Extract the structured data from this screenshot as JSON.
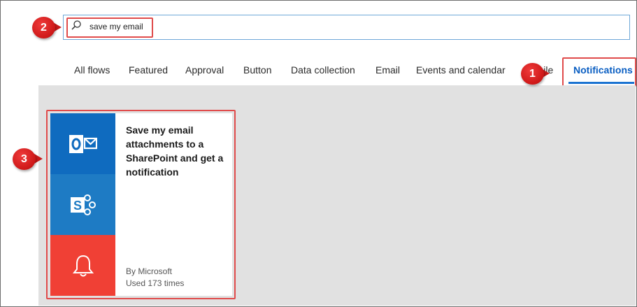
{
  "search": {
    "value": "save my email"
  },
  "tabs": [
    {
      "label": "All flows",
      "active": false
    },
    {
      "label": "Featured",
      "active": false
    },
    {
      "label": "Approval",
      "active": false
    },
    {
      "label": "Button",
      "active": false
    },
    {
      "label": "Data collection",
      "active": false
    },
    {
      "label": "Email",
      "active": false
    },
    {
      "label": "Events and calendar",
      "active": false
    },
    {
      "label": "Mobile",
      "active": false
    },
    {
      "label": "Notifications",
      "active": true
    }
  ],
  "card": {
    "title": "Save my email attachments to a SharePoint and get a notification",
    "author": "By Microsoft",
    "usage": "Used 173 times",
    "icons": [
      "outlook-icon",
      "sharepoint-icon",
      "notification-bell-icon"
    ]
  },
  "callouts": {
    "one": "1",
    "two": "2",
    "three": "3"
  },
  "colors": {
    "highlight": "#e04b4b",
    "callout": "#d01a1a",
    "active_tab": "#0a5ec2",
    "outlook_tile": "#0f6bbf",
    "sharepoint_tile": "#1e7bc4",
    "notification_tile": "#f04035",
    "content_bg": "#e1e1e1"
  }
}
